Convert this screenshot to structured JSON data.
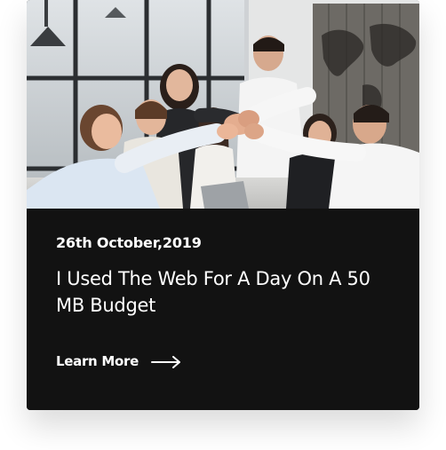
{
  "post": {
    "date": "26th October,2019",
    "title": "I Used The Web For A Day On A 50 MB Budget",
    "cta_label": "Learn More"
  },
  "icons": {
    "cta": "arrow-right-icon"
  },
  "colors": {
    "card_background": "#121212",
    "text": "#ffffff"
  }
}
